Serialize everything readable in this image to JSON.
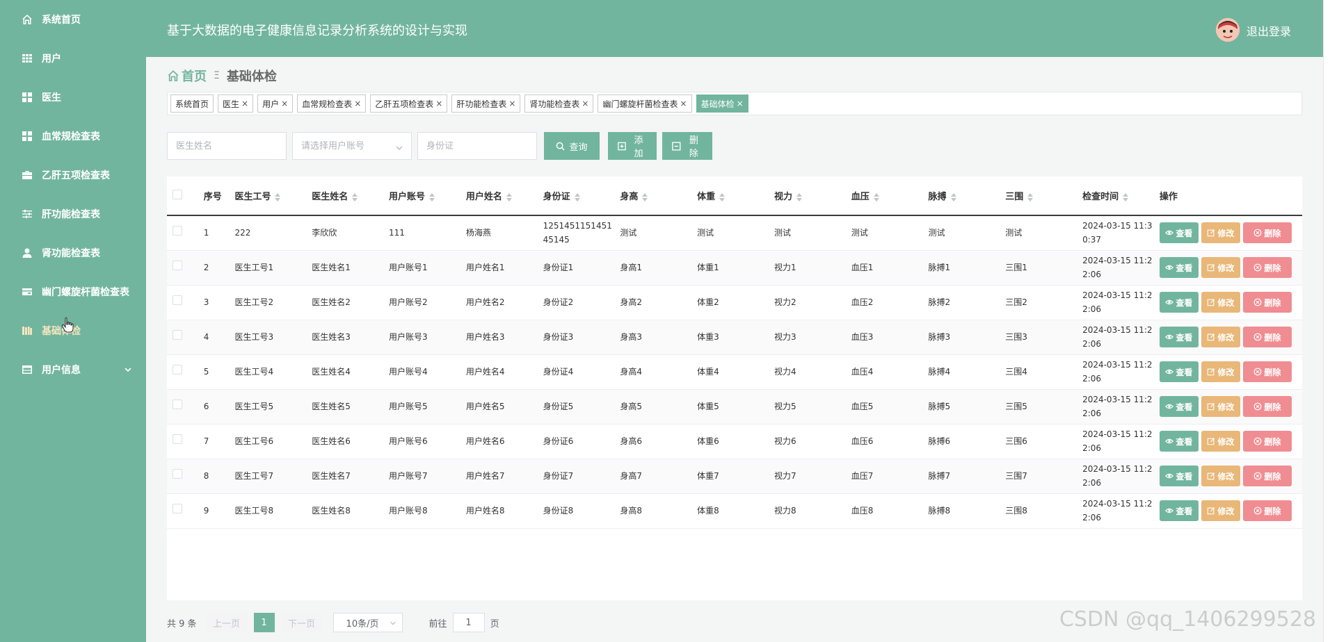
{
  "sidebar": {
    "items": [
      {
        "label": "系统首页",
        "icon": "home-icon"
      },
      {
        "label": "用户",
        "icon": "grid-icon"
      },
      {
        "label": "医生",
        "icon": "apps-icon"
      },
      {
        "label": "血常规检查表",
        "icon": "apps-icon"
      },
      {
        "label": "乙肝五项检查表",
        "icon": "briefcase-icon"
      },
      {
        "label": "肝功能检查表",
        "icon": "sliders-icon"
      },
      {
        "label": "肾功能检查表",
        "icon": "user-icon"
      },
      {
        "label": "幽门螺旋杆菌检查表",
        "icon": "card-icon"
      },
      {
        "label": "基础体检",
        "icon": "books-icon",
        "active": true
      },
      {
        "label": "用户信息",
        "icon": "window-icon",
        "has_submenu": true
      }
    ]
  },
  "header": {
    "title": "基于大数据的电子健康信息记录分析系统的设计与实现",
    "logout_label": "退出登录"
  },
  "breadcrumb": {
    "home": "首页",
    "separator": "Ξ",
    "current": "基础体检"
  },
  "tags": [
    {
      "label": "系统首页",
      "closable": false
    },
    {
      "label": "医生",
      "closable": true
    },
    {
      "label": "用户",
      "closable": true
    },
    {
      "label": "血常规检查表",
      "closable": true
    },
    {
      "label": "乙肝五项检查表",
      "closable": true
    },
    {
      "label": "肝功能检查表",
      "closable": true
    },
    {
      "label": "肾功能检查表",
      "closable": true
    },
    {
      "label": "幽门螺旋杆菌检查表",
      "closable": true
    },
    {
      "label": "基础体检",
      "closable": true,
      "active": true
    }
  ],
  "search": {
    "doctor_name_placeholder": "医生姓名",
    "user_account_placeholder": "请选择用户账号",
    "id_card_placeholder": "身份证",
    "query_label": "查询",
    "add_label": "添加",
    "delete_label": "删除"
  },
  "table": {
    "columns": [
      "序号",
      "医生工号",
      "医生姓名",
      "用户账号",
      "用户姓名",
      "身份证",
      "身高",
      "体重",
      "视力",
      "血压",
      "脉搏",
      "三围",
      "检查时间",
      "操作"
    ],
    "sortable": [
      false,
      true,
      true,
      true,
      true,
      true,
      true,
      true,
      true,
      true,
      true,
      true,
      true,
      false
    ],
    "actions": {
      "view": "查看",
      "edit": "修改",
      "delete": "删除"
    },
    "rows": [
      [
        "1",
        "222",
        "李欣欣",
        "111",
        "杨海燕",
        "125145115145145145",
        "测试",
        "测试",
        "测试",
        "测试",
        "测试",
        "测试",
        "2024-03-15 11:30:37"
      ],
      [
        "2",
        "医生工号1",
        "医生姓名1",
        "用户账号1",
        "用户姓名1",
        "身份证1",
        "身高1",
        "体重1",
        "视力1",
        "血压1",
        "脉搏1",
        "三围1",
        "2024-03-15 11:22:06"
      ],
      [
        "3",
        "医生工号2",
        "医生姓名2",
        "用户账号2",
        "用户姓名2",
        "身份证2",
        "身高2",
        "体重2",
        "视力2",
        "血压2",
        "脉搏2",
        "三围2",
        "2024-03-15 11:22:06"
      ],
      [
        "4",
        "医生工号3",
        "医生姓名3",
        "用户账号3",
        "用户姓名3",
        "身份证3",
        "身高3",
        "体重3",
        "视力3",
        "血压3",
        "脉搏3",
        "三围3",
        "2024-03-15 11:22:06"
      ],
      [
        "5",
        "医生工号4",
        "医生姓名4",
        "用户账号4",
        "用户姓名4",
        "身份证4",
        "身高4",
        "体重4",
        "视力4",
        "血压4",
        "脉搏4",
        "三围4",
        "2024-03-15 11:22:06"
      ],
      [
        "6",
        "医生工号5",
        "医生姓名5",
        "用户账号5",
        "用户姓名5",
        "身份证5",
        "身高5",
        "体重5",
        "视力5",
        "血压5",
        "脉搏5",
        "三围5",
        "2024-03-15 11:22:06"
      ],
      [
        "7",
        "医生工号6",
        "医生姓名6",
        "用户账号6",
        "用户姓名6",
        "身份证6",
        "身高6",
        "体重6",
        "视力6",
        "血压6",
        "脉搏6",
        "三围6",
        "2024-03-15 11:22:06"
      ],
      [
        "8",
        "医生工号7",
        "医生姓名7",
        "用户账号7",
        "用户姓名7",
        "身份证7",
        "身高7",
        "体重7",
        "视力7",
        "血压7",
        "脉搏7",
        "三围7",
        "2024-03-15 11:22:06"
      ],
      [
        "9",
        "医生工号8",
        "医生姓名8",
        "用户账号8",
        "用户姓名8",
        "身份证8",
        "身高8",
        "体重8",
        "视力8",
        "血压8",
        "脉搏8",
        "三围8",
        "2024-03-15 11:22:06"
      ]
    ]
  },
  "pagination": {
    "total_text": "共 9 条",
    "prev_label": "上一页",
    "current_page": "1",
    "next_label": "下一页",
    "page_size": "10条/页",
    "goto_prefix": "前往",
    "goto_value": "1",
    "goto_suffix": "页"
  },
  "watermark": "CSDN @qq_1406299528",
  "colors": {
    "primary": "#72b59e",
    "edit": "#e9b778",
    "danger": "#f08d92",
    "active_menu_text": "#f7e6c0"
  }
}
